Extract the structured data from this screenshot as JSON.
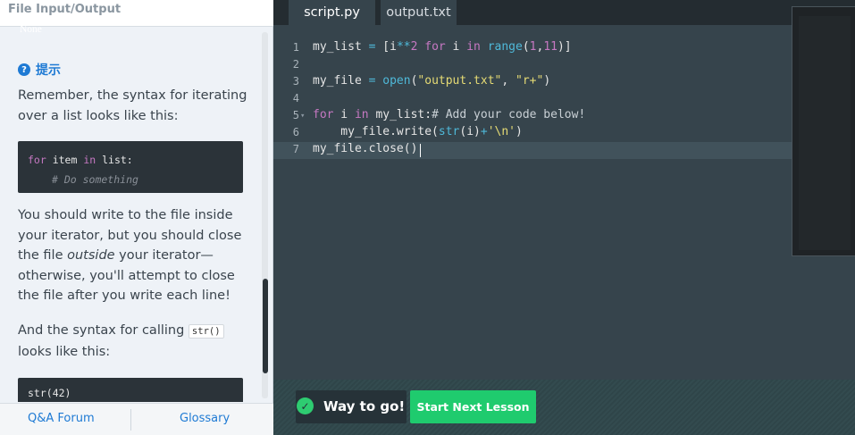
{
  "lesson": {
    "title": "File Input/Output"
  },
  "hint": {
    "icon": "question-circle-icon",
    "label": "提示",
    "paragraph1": "Remember, the syntax for iterating over a list looks like this:",
    "code1_line1_kw1": "for",
    "code1_line1_var": " item ",
    "code1_line1_kw2": "in",
    "code1_line1_rest": " list:",
    "code1_line2": "# Do something",
    "paragraph2_a": "You should write to the file inside your iterator, but you should close the file ",
    "paragraph2_em": "outside",
    "paragraph2_b": " your iterator—otherwise, you'll attempt to close the file after you write each line!",
    "paragraph3_a": "And the syntax for calling ",
    "paragraph3_code": "str()",
    "paragraph3_b": " looks like this:",
    "code2_line1": "str(42)"
  },
  "footer": {
    "qa_label": "Q&A Forum",
    "glossary_label": "Glossary"
  },
  "tabs": [
    {
      "label": "script.py"
    },
    {
      "label": "output.txt"
    }
  ],
  "editor": {
    "line_numbers": [
      "1",
      "2",
      "3",
      "4",
      "5",
      "6",
      "7"
    ],
    "fold_marker": "▾",
    "l1": {
      "a": "my_list ",
      "op": "=",
      "b": " [i",
      "pow": "**",
      "n2": "2",
      "c": " ",
      "for": "for",
      "d": " i ",
      "in": "in",
      "e": " ",
      "range": "range",
      "f": "(",
      "n1": "1",
      "g": ",",
      "n11": "11",
      "h": ")]"
    },
    "l3": {
      "a": "my_file ",
      "op": "=",
      "b": " ",
      "open": "open",
      "c": "(",
      "s1": "\"output.txt\"",
      "d": ", ",
      "s2": "\"r+\"",
      "e": ")"
    },
    "l5": {
      "for": "for",
      "a": " i ",
      "in": "in",
      "b": " my_list:",
      "cmt": "# Add your code below!"
    },
    "l6": {
      "a": "    my_file.write(",
      "str": "str",
      "b": "(i)",
      "op": "+",
      "s": "'\\n'",
      "c": ")"
    },
    "l7": {
      "a": "my_file.close()"
    }
  },
  "output": {
    "text": "None"
  },
  "result": {
    "check_icon": "check-icon",
    "message": "Way to go!",
    "next_label": "Start Next Lesson"
  },
  "colors": {
    "accent": "#1e7ad4",
    "success": "#1fcb6e",
    "editor_bg": "#36444c"
  }
}
